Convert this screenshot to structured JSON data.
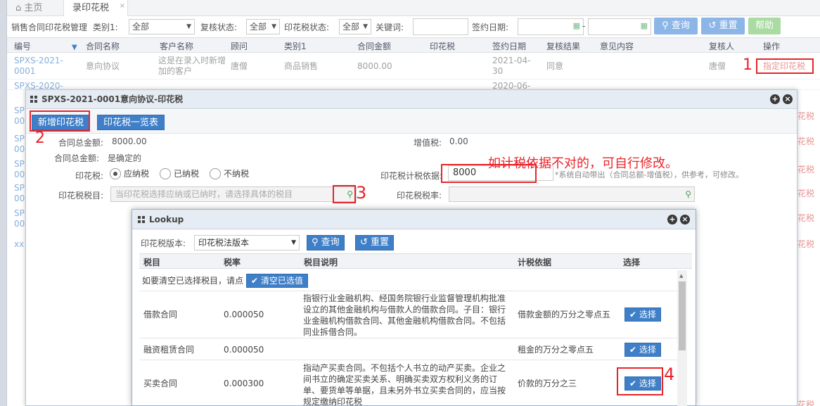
{
  "tabs": {
    "home": "主页",
    "active": "录印花税"
  },
  "filter": {
    "breadcrumb": "销售合同印花税管理",
    "category_label": "类别1:",
    "category_value": "全部",
    "review_label": "复核状态:",
    "review_value": "全部",
    "stamp_status_label": "印花税状态:",
    "stamp_status_value": "全部",
    "keyword_label": "关键词:",
    "sign_date_label": "签约日期:",
    "date_dash": "-",
    "query_btn": "查询",
    "reset_btn": "重置",
    "help_btn": "帮助"
  },
  "grid": {
    "headers": [
      "编号",
      "合同名称",
      "客户名称",
      "顾问",
      "类别1",
      "合同金额",
      "印花税",
      "签约日期",
      "复核结果",
      "意见内容",
      "复核人",
      "操作"
    ],
    "row1": {
      "id": "SPXS-2021-0001",
      "name": "意向协议",
      "customer": "这是在录入时新增加的客户",
      "advisor": "唐僧",
      "category": "商品销售",
      "amount": "8000.00",
      "date": "2021-04-30",
      "result": "同意",
      "reviewer": "唐僧",
      "action": "指定印花税"
    },
    "row2": {
      "id": "SPXS-2020-",
      "date": "2020-06-"
    },
    "left_ids": [
      "SP",
      "00",
      "SP",
      "00",
      "SP",
      "00",
      "SP",
      "00",
      "SP",
      "00",
      "xx"
    ],
    "right_actions": [
      "花税",
      "花税",
      "花税",
      "花税",
      "花税",
      "花税",
      "花税"
    ]
  },
  "dialog": {
    "title": "SPXS-2021-0001意向协议-印花税",
    "new_btn": "新增印花税",
    "list_btn": "印花税一览表",
    "total_label": "合同总金额:",
    "total_value": "8000.00",
    "vat_label": "增值税:",
    "vat_value": "0.00",
    "total_label2": "合同总金额:",
    "total_value2": "是确定的",
    "stamp_label": "印花税:",
    "radio_options": [
      "应纳税",
      "已纳税",
      "不纳税"
    ],
    "basis_label": "印花税计税依据:",
    "basis_value": "8000",
    "basis_hint": "*系统自动带出（合同总额-增值税），供参考，可修改。",
    "item_label": "印花税税目:",
    "item_placeholder": "当印花税选择应纳或已纳时，请选择具体的税目",
    "rate_label": "印花税税率:"
  },
  "annotations": {
    "n1": "1",
    "n2": "2",
    "n3": "3",
    "n4": "4",
    "note": "如计税依据不对的，可自行修改。"
  },
  "lookup": {
    "title": "Lookup",
    "version_label": "印花税版本:",
    "version_value": "印花税法版本",
    "query_btn": "查询",
    "reset_btn": "重置",
    "headers": [
      "税目",
      "税率",
      "税目说明",
      "计税依据",
      "选择"
    ],
    "clear_text": "如要清空已选择税目，请点",
    "clear_btn": "清空已选值",
    "rows": [
      {
        "item": "借款合同",
        "rate": "0.000050",
        "desc": "指银行业金融机构、经国务院银行业监督管理机构批准设立的其他金融机构与借款人的借款合同。子目：银行业金融机构借款合同、其他金融机构借款合同。不包括同业拆借合同。",
        "basis": "借款金额的万分之零点五",
        "pick": "选择"
      },
      {
        "item": "融资租赁合同",
        "rate": "0.000050",
        "desc": "",
        "basis": "租金的万分之零点五",
        "pick": "选择"
      },
      {
        "item": "买卖合同",
        "rate": "0.000300",
        "desc": "指动产买卖合同。不包括个人书立的动产买卖。企业之间书立的确定买卖关系、明确买卖双方权利义务的订单、要货单等单据，且未另外书立买卖合同的，应当按规定缴纳印花税",
        "basis": "价款的万分之三",
        "pick": "选择"
      }
    ]
  },
  "colors": {
    "primary": "#3f7fc8",
    "annotation": "#e8242a",
    "link": "#3a7fc9"
  }
}
